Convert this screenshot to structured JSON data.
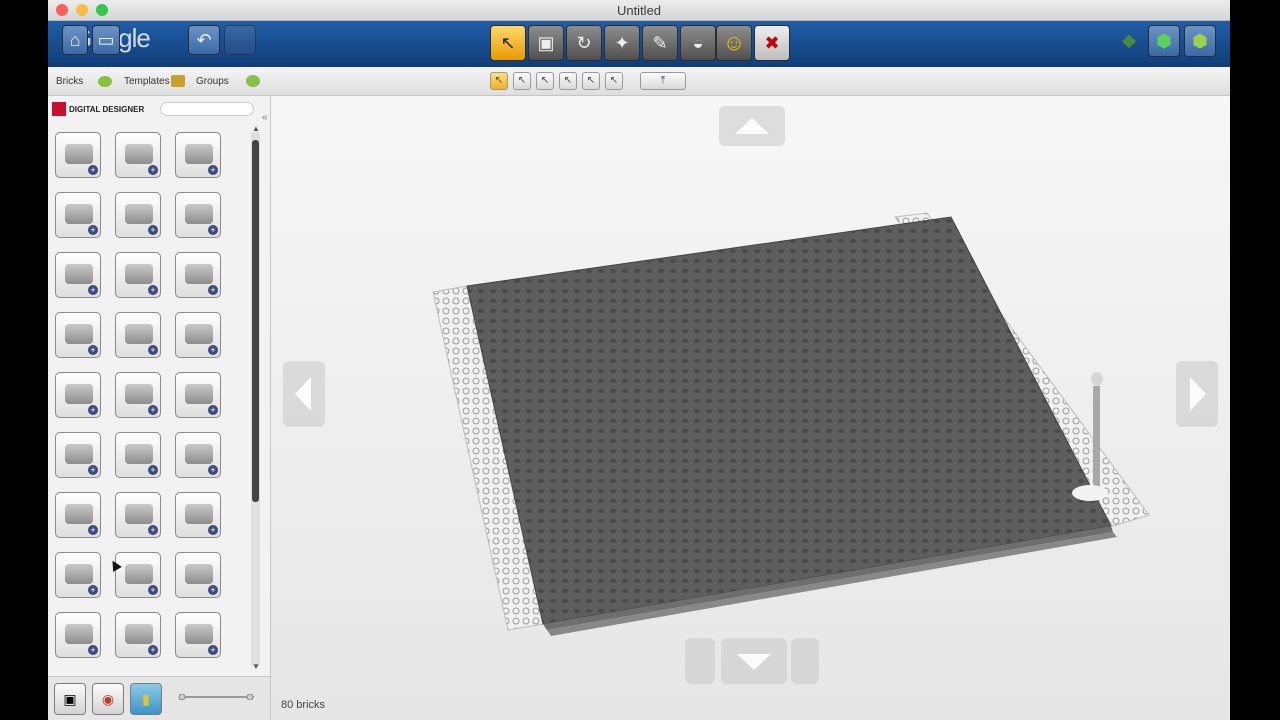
{
  "window": {
    "title": "Untitled"
  },
  "toolbar": {
    "brand": "Google",
    "tools": [
      {
        "icon": "pointer-icon",
        "glyph": "↖"
      },
      {
        "icon": "clone-icon",
        "glyph": "▣"
      },
      {
        "icon": "hinge-icon",
        "glyph": "↻"
      },
      {
        "icon": "flex-icon",
        "glyph": "✦"
      },
      {
        "icon": "paint-icon",
        "glyph": "✎"
      },
      {
        "icon": "hide-icon",
        "glyph": "◒"
      },
      {
        "icon": "minifig-icon",
        "glyph": "☺"
      },
      {
        "icon": "delete-icon",
        "glyph": "✖"
      }
    ]
  },
  "tabs": {
    "bricks": "Bricks",
    "templates": "Templates",
    "groups": "Groups"
  },
  "sidebar": {
    "brand": "DIGITAL DESIGNER",
    "search_placeholder": "",
    "brick_count_cells": 27
  },
  "status": {
    "text": "80 bricks"
  },
  "colors": {
    "accent": "#1b4f8f",
    "delete": "#c40000",
    "minifig": "#f2c200",
    "baseplate": "#5f5f5f"
  }
}
